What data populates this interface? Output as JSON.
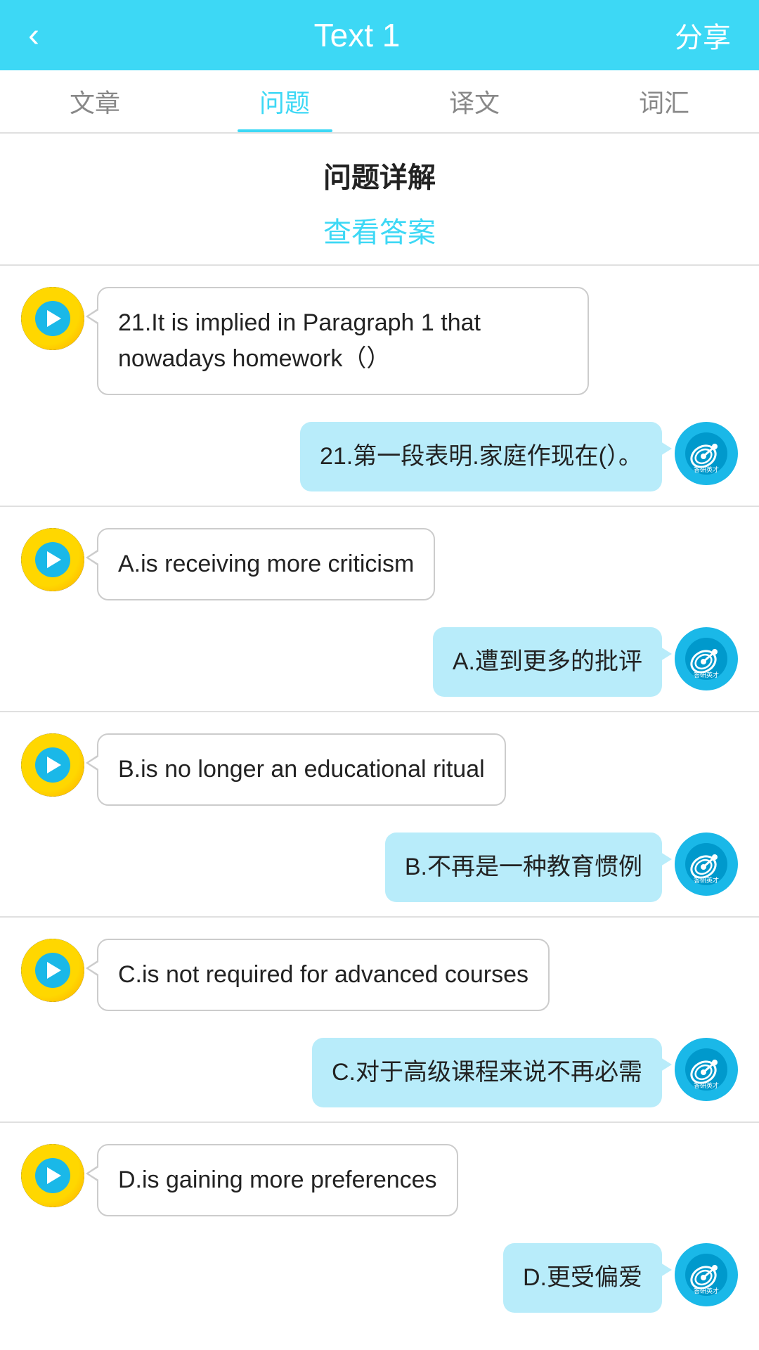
{
  "header": {
    "back_label": "‹",
    "title": "Text 1",
    "share_label": "分享"
  },
  "tabs": [
    {
      "id": "wenzhang",
      "label": "文章",
      "active": false
    },
    {
      "id": "wenti",
      "label": "问题",
      "active": true
    },
    {
      "id": "yiwen",
      "label": "译文",
      "active": false
    },
    {
      "id": "cihui",
      "label": "词汇",
      "active": false
    }
  ],
  "section": {
    "title": "问题详解",
    "view_answer": "查看答案"
  },
  "chat_pairs": [
    {
      "id": "q21",
      "bot_text": "21.It is implied in Paragraph 1 that nowadays homework（）",
      "user_text": "21.第一段表明.家庭作现在(）。"
    },
    {
      "id": "optA",
      "bot_text": "A.is receiving more criticism",
      "user_text": "A.遭到更多的批评"
    },
    {
      "id": "optB",
      "bot_text": "B.is no longer an educational ritual",
      "user_text": "B.不再是一种教育惯例"
    },
    {
      "id": "optC",
      "bot_text": "C.is not required for advanced courses",
      "user_text": "C.对于高级课程来说不再必需"
    },
    {
      "id": "optD",
      "bot_text": "D.is gaining more preferences",
      "user_text": "D.更受偏爱"
    }
  ]
}
